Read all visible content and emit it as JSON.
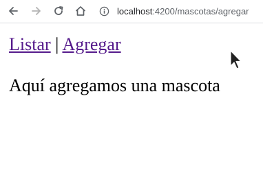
{
  "browser": {
    "url_host": "localhost",
    "url_path": ":4200/mascotas/agregar",
    "icons": {
      "back": "arrow-left-icon",
      "forward": "arrow-right-icon",
      "reload": "reload-icon",
      "home": "home-icon",
      "info": "info-icon"
    }
  },
  "nav": {
    "listar_label": "Listar",
    "separator": "|",
    "agregar_label": "Agregar"
  },
  "page": {
    "heading": "Aquí agregamos una mascota"
  },
  "colors": {
    "visited_link": "#551a8b",
    "text": "#000000",
    "toolbar_icon": "#5f6368",
    "toolbar_icon_disabled": "#b3b3b3"
  }
}
